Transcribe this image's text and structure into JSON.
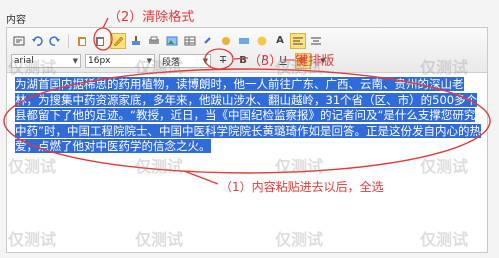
{
  "page": {
    "field_label": "内容"
  },
  "toolbar": {
    "row1_icons": [
      "source-icon",
      "undo-icon",
      "redo-icon",
      "paste-icon",
      "paste-text-icon",
      "clear-format-icon",
      "brush-icon",
      "print-icon",
      "bold-icon",
      "italic-icon",
      "underline-icon",
      "strike-icon",
      "sub-icon",
      "sup-icon",
      "color-icon",
      "bgcolor-icon",
      "align-left-icon",
      "align-center-icon"
    ],
    "font_color_glyph": "A",
    "font_family": "arial",
    "font_size": "16px",
    "paragraph": "段落",
    "caret": "▼",
    "clear_glyph": "T",
    "bold_glyph": "B",
    "italic_glyph": "I",
    "underline_glyph": "U"
  },
  "content": {
    "text": "为湖首国内据稀思的药用植物，读博朗时，他一人前往广东、广西、云南、贵州的深山老林，为搜集中药资源家底，多年来，他跋山涉水、翻山越岭，31个省（区、市）的500多个县都留下了他的足迹。“教授，近日，当《中国纪检监察报》的记者问及“是什么支撑您研究中药”时，中国工程院院士、中国中医科学院院长黄璐琦作如是回答。正是这份发自内心的热爱，点燃了他对中医药学的信念之火。"
  },
  "annotations": {
    "clear_format": "（2）清除格式",
    "one_click": "（3）一键排版",
    "paste_select": "（1）内容粘贴进去以后，全选"
  },
  "watermark": {
    "text": "仅测试"
  },
  "colors": {
    "annotation": "#e53939",
    "highlight": "#2f6bd9",
    "active": "#ffe27a"
  }
}
